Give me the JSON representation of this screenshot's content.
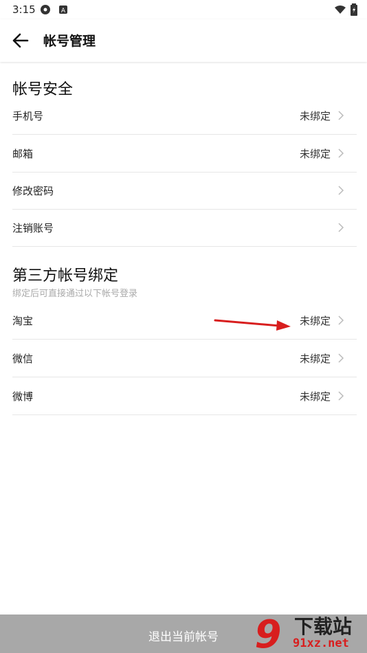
{
  "status_bar": {
    "time": "3:15",
    "icons": [
      "settings-gear-icon",
      "app-a-icon",
      "wifi-icon",
      "battery-icon"
    ]
  },
  "app_bar": {
    "title": "帐号管理",
    "back_icon": "arrow-left-icon"
  },
  "account_security": {
    "title": "帐号安全",
    "items": [
      {
        "label": "手机号",
        "value": "未绑定"
      },
      {
        "label": "邮箱",
        "value": "未绑定"
      },
      {
        "label": "修改密码",
        "value": ""
      },
      {
        "label": "注销账号",
        "value": ""
      }
    ]
  },
  "third_party": {
    "title": "第三方帐号绑定",
    "subtitle": "绑定后可直接通过以下帐号登录",
    "items": [
      {
        "label": "淘宝",
        "value": "未绑定"
      },
      {
        "label": "微信",
        "value": "未绑定"
      },
      {
        "label": "微博",
        "value": "未绑定"
      }
    ]
  },
  "logout_label": "退出当前帐号",
  "watermark": {
    "text_top": "下载站",
    "text_bottom": "91xz.net",
    "logo_number": "9"
  },
  "colors": {
    "accent_arrow": "#d81e1e",
    "logout_bg": "#a8a8a8",
    "divider": "#e6e6e6",
    "subtitle": "#aaaaaa"
  }
}
